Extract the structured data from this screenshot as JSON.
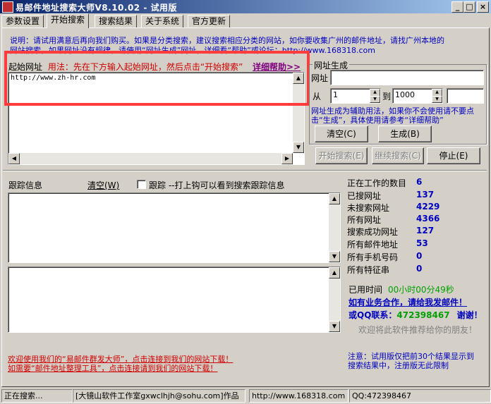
{
  "window": {
    "title": "易邮件地址搜索大师V8.10.02 - 试用版",
    "minimize_glyph": "_",
    "maximize_glyph": "□",
    "close_glyph": "×"
  },
  "tabs": [
    {
      "label": "参数设置"
    },
    {
      "label": "开始搜索"
    },
    {
      "label": "搜索结果"
    },
    {
      "label": "关于系统"
    },
    {
      "label": "官方更新"
    }
  ],
  "notice": {
    "line1": "说明：请试用满意后再向我们购买。如果是分类搜索，建议搜索相应分类的网站，如你要收集广州的邮件地址，请找广州本地的",
    "line2": "网站搜索，如果网址没有规律，请使用“网址生成”网址，详细看“帮助”或论坛：http://www.168318.com"
  },
  "start_url": {
    "label": "起始网址",
    "usage": "用法：先在下方输入起始网址，然后点击“开始搜索”",
    "help_link": "详细帮助>>",
    "value": "http://www.zh-hr.com"
  },
  "url_gen": {
    "group_title": "网址生成",
    "url_label": "网址",
    "url_value": "",
    "from_label": "从",
    "from_value": "1",
    "to_label": "到",
    "to_value": "1000",
    "extra_value": "",
    "hint": "网址生成为辅助用法，如果你不会使用请不要点击“生成”，具体使用请参考“详细帮助”",
    "clear_button": "清空(C)",
    "generate_button": "生成(B)"
  },
  "actions": {
    "start_button": "开始搜索(E)",
    "continue_button": "继续搜索(C)",
    "stop_button": "停止(E)"
  },
  "trace": {
    "label": "跟踪信息",
    "clear": "清空(W)",
    "checkbox_label": "跟踪 --打上钩可以看到搜索跟踪信息",
    "checked": false
  },
  "stats": [
    {
      "label": "正在工作的数目",
      "value": "6"
    },
    {
      "label": "已搜网址",
      "value": "137"
    },
    {
      "label": "未搜索网址",
      "value": "4229"
    },
    {
      "label": "所有网址",
      "value": "4366"
    },
    {
      "label": "搜索成功网址",
      "value": "127"
    },
    {
      "label": "所有邮件地址",
      "value": "53"
    },
    {
      "label": "所有手机号码",
      "value": "0"
    },
    {
      "label": "所有特征串",
      "value": "0"
    }
  ],
  "elapsed": {
    "label": "已用时间",
    "value": "00小时00分49秒"
  },
  "promo": {
    "cooperate": "如有业务合作，请给我发邮件！",
    "qq_prefix": "或QQ联系：",
    "qq": "472398467",
    "thanks": "谢谢！",
    "recommend": "欢迎将此软件推荐给你的朋友！"
  },
  "footer_links": {
    "line1": "欢迎使用我们的“易邮件群发大师”，点击连接到我们的网站下载！",
    "line2": "如需要“邮件地址整理工具”，点击连接请到我们的网站下载！"
  },
  "trial_note": {
    "line1": "注意：试用版仅把前30个结果显示到",
    "line2": "搜索结果中，注册版无此限制"
  },
  "statusbar": {
    "status": "正在搜索...",
    "studio": "[大镜山软件工作室gxwclhjh@sohu.com]作品",
    "website": "http://www.168318.com",
    "qq": "QQ:472398467"
  },
  "colors": {
    "highlight_box": "#ff3b3b",
    "stat_value": "#0000c0",
    "elapsed_value": "#00a000",
    "footer_link": "#d00000"
  }
}
